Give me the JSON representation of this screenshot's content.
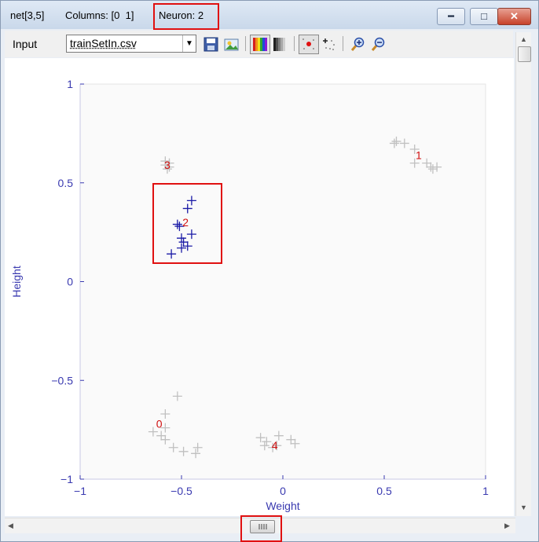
{
  "window": {
    "net_label": "net[3,5]",
    "columns_label": "Columns: [0  1]",
    "neuron_label": "Neuron: 2"
  },
  "toolbar": {
    "input_label": "Input",
    "file_select_value": "trainSetIn.csv",
    "icons": [
      "save-icon",
      "open-image-icon",
      "color-palette-icon",
      "grayscale-palette-icon",
      "show-neurons-icon",
      "show-points-icon",
      "zoom-in-icon",
      "zoom-out-icon"
    ]
  },
  "colors": {
    "highlight": "#e01010",
    "selected_points": "#1a1aa6",
    "other_points": "#c0c0c0",
    "neuron_label": "#d01010",
    "axis": "#3a3ab0"
  },
  "chart_data": {
    "type": "scatter",
    "xlabel": "Weight",
    "ylabel": "Height",
    "xlim": [
      -1,
      1
    ],
    "ylim": [
      -1,
      1
    ],
    "xticks": [
      -1,
      -0.5,
      0,
      0.5,
      1
    ],
    "yticks": [
      -1,
      -0.5,
      0,
      0.5,
      1
    ],
    "xtick_labels": [
      "−1",
      "−0.5",
      "0",
      "0.5",
      "1"
    ],
    "ytick_labels": [
      "−1",
      "−0.5",
      "0",
      "0.5",
      "1"
    ],
    "selected_neuron": 2,
    "neurons": [
      {
        "label": "0",
        "x": -0.61,
        "y": -0.72
      },
      {
        "label": "1",
        "x": 0.67,
        "y": 0.64
      },
      {
        "label": "2",
        "x": -0.48,
        "y": 0.3
      },
      {
        "label": "3",
        "x": -0.57,
        "y": 0.59
      },
      {
        "label": "4",
        "x": -0.04,
        "y": -0.83
      }
    ],
    "series": [
      {
        "cluster": 0,
        "points": [
          [
            -0.52,
            -0.58
          ],
          [
            -0.58,
            -0.67
          ],
          [
            -0.58,
            -0.74
          ],
          [
            -0.6,
            -0.78
          ],
          [
            -0.64,
            -0.76
          ],
          [
            -0.58,
            -0.8
          ],
          [
            -0.54,
            -0.84
          ],
          [
            -0.49,
            -0.86
          ],
          [
            -0.42,
            -0.84
          ],
          [
            -0.43,
            -0.87
          ]
        ]
      },
      {
        "cluster": 1,
        "points": [
          [
            0.55,
            0.7
          ],
          [
            0.56,
            0.71
          ],
          [
            0.6,
            0.7
          ],
          [
            0.65,
            0.67
          ],
          [
            0.65,
            0.6
          ],
          [
            0.71,
            0.6
          ],
          [
            0.74,
            0.57
          ],
          [
            0.76,
            0.58
          ],
          [
            0.73,
            0.58
          ]
        ]
      },
      {
        "cluster": 2,
        "points": [
          [
            -0.45,
            0.41
          ],
          [
            -0.47,
            0.37
          ],
          [
            -0.52,
            0.29
          ],
          [
            -0.51,
            0.28
          ],
          [
            -0.45,
            0.24
          ],
          [
            -0.5,
            0.22
          ],
          [
            -0.49,
            0.2
          ],
          [
            -0.47,
            0.18
          ],
          [
            -0.5,
            0.17
          ],
          [
            -0.55,
            0.14
          ]
        ]
      },
      {
        "cluster": 3,
        "points": [
          [
            -0.58,
            0.61
          ],
          [
            -0.56,
            0.6
          ],
          [
            -0.58,
            0.59
          ],
          [
            -0.56,
            0.58
          ],
          [
            -0.57,
            0.57
          ]
        ]
      },
      {
        "cluster": 4,
        "points": [
          [
            -0.11,
            -0.79
          ],
          [
            -0.09,
            -0.83
          ],
          [
            -0.02,
            -0.78
          ],
          [
            -0.03,
            -0.83
          ],
          [
            -0.05,
            -0.84
          ],
          [
            0.04,
            -0.8
          ],
          [
            0.06,
            -0.82
          ],
          [
            -0.08,
            -0.81
          ]
        ]
      }
    ]
  }
}
